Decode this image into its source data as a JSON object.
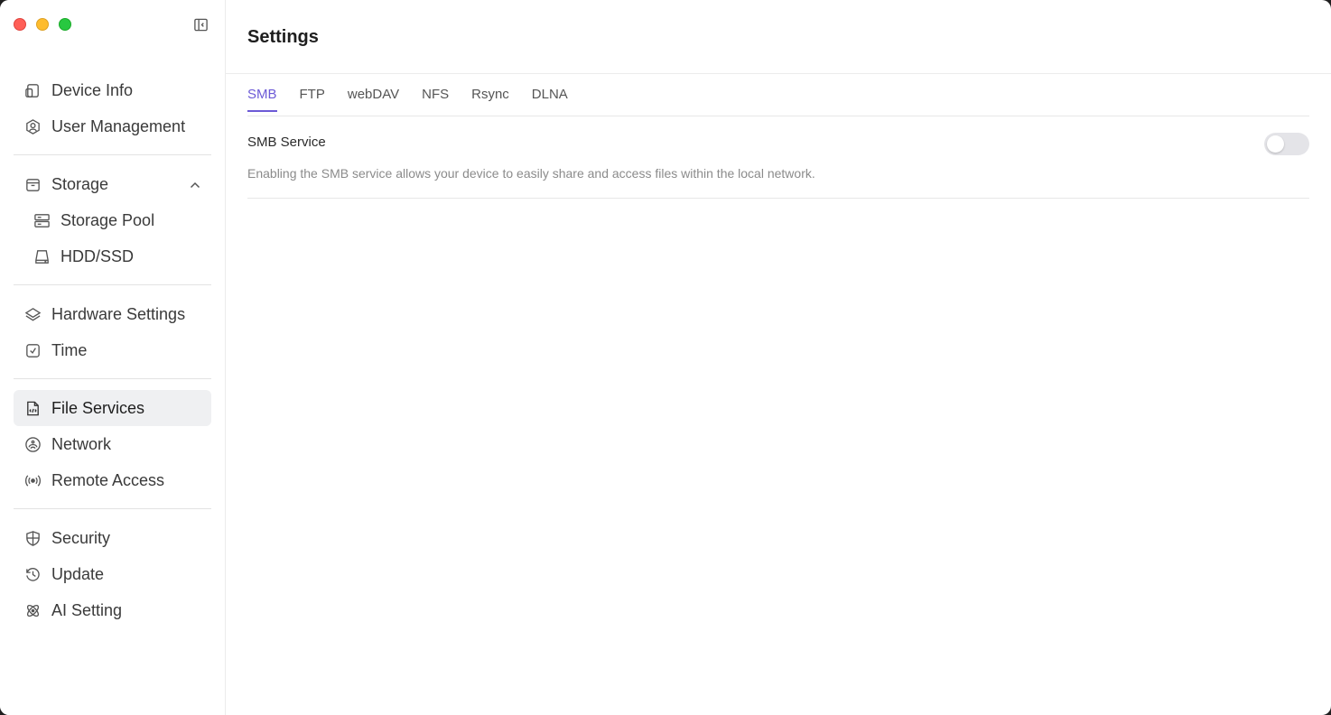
{
  "page": {
    "title": "Settings"
  },
  "sidebar": {
    "items": [
      {
        "id": "device-info",
        "label": "Device Info",
        "icon": "device-icon"
      },
      {
        "id": "user-management",
        "label": "User Management",
        "icon": "user-icon"
      },
      {
        "id": "storage",
        "label": "Storage",
        "icon": "storage-icon",
        "expanded": true
      },
      {
        "id": "storage-pool",
        "label": "Storage Pool",
        "icon": "storage-pool-icon",
        "sub": true
      },
      {
        "id": "hdd-ssd",
        "label": "HDD/SSD",
        "icon": "disk-icon",
        "sub": true
      },
      {
        "id": "hardware-settings",
        "label": "Hardware Settings",
        "icon": "layers-icon"
      },
      {
        "id": "time",
        "label": "Time",
        "icon": "clock-icon"
      },
      {
        "id": "file-services",
        "label": "File Services",
        "icon": "file-icon",
        "active": true
      },
      {
        "id": "network",
        "label": "Network",
        "icon": "network-icon"
      },
      {
        "id": "remote-access",
        "label": "Remote Access",
        "icon": "broadcast-icon"
      },
      {
        "id": "security",
        "label": "Security",
        "icon": "shield-icon"
      },
      {
        "id": "update",
        "label": "Update",
        "icon": "history-icon"
      },
      {
        "id": "ai-setting",
        "label": "AI Setting",
        "icon": "atom-icon"
      }
    ]
  },
  "tabs": [
    {
      "label": "SMB",
      "active": true
    },
    {
      "label": "FTP"
    },
    {
      "label": "webDAV"
    },
    {
      "label": "NFS"
    },
    {
      "label": "Rsync"
    },
    {
      "label": "DLNA"
    }
  ],
  "service": {
    "title": "SMB Service",
    "description": "Enabling the SMB service allows your device to easily share and access files within the local network.",
    "enabled": false
  },
  "colors": {
    "accent": "#6c5ad6",
    "active_bg": "#eff0f2"
  }
}
